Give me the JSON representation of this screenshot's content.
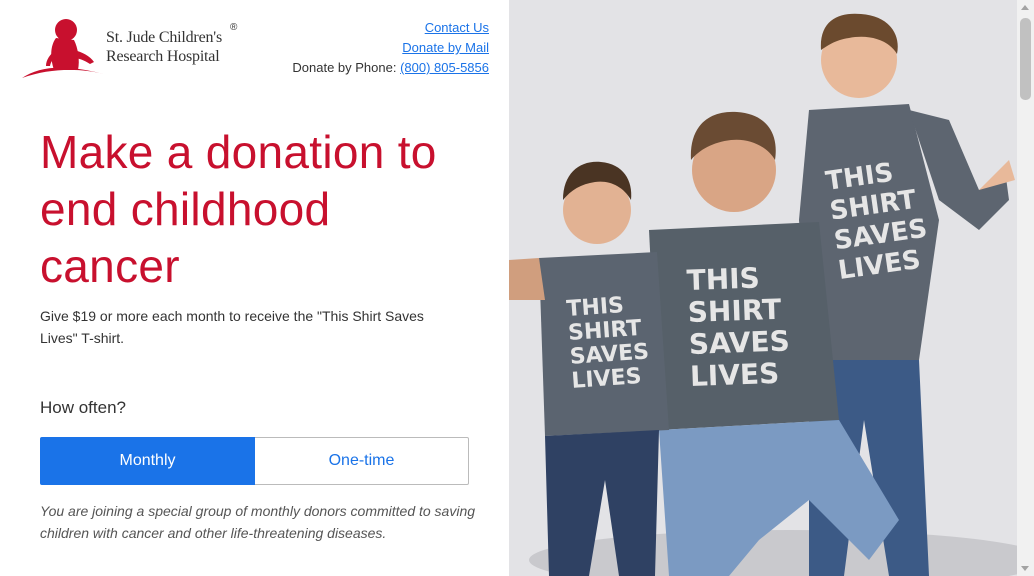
{
  "header": {
    "logo_line1": "St. Jude Children's",
    "logo_line2": "Research Hospital",
    "logo_reg": "®",
    "contact_us": "Contact Us",
    "donate_by_mail": "Donate by Mail",
    "donate_by_phone_label": "Donate by Phone:",
    "phone": "(800) 805-5856"
  },
  "hero": {
    "title": "Make a donation to end childhood cancer",
    "subtitle": "Give $19 or more each month to receive the \"This Shirt Saves Lives\" T-shirt."
  },
  "frequency": {
    "label": "How often?",
    "options": [
      "Monthly",
      "One-time"
    ],
    "selected": "Monthly",
    "note": "You are joining a special group of monthly donors committed to saving children with cancer and other life-threatening diseases."
  },
  "photo": {
    "shirt_words": [
      "THIS",
      "SHIRT",
      "SAVES",
      "LIVES"
    ]
  },
  "colors": {
    "brand_red": "#c8102e",
    "accent_blue": "#1a73e8"
  }
}
